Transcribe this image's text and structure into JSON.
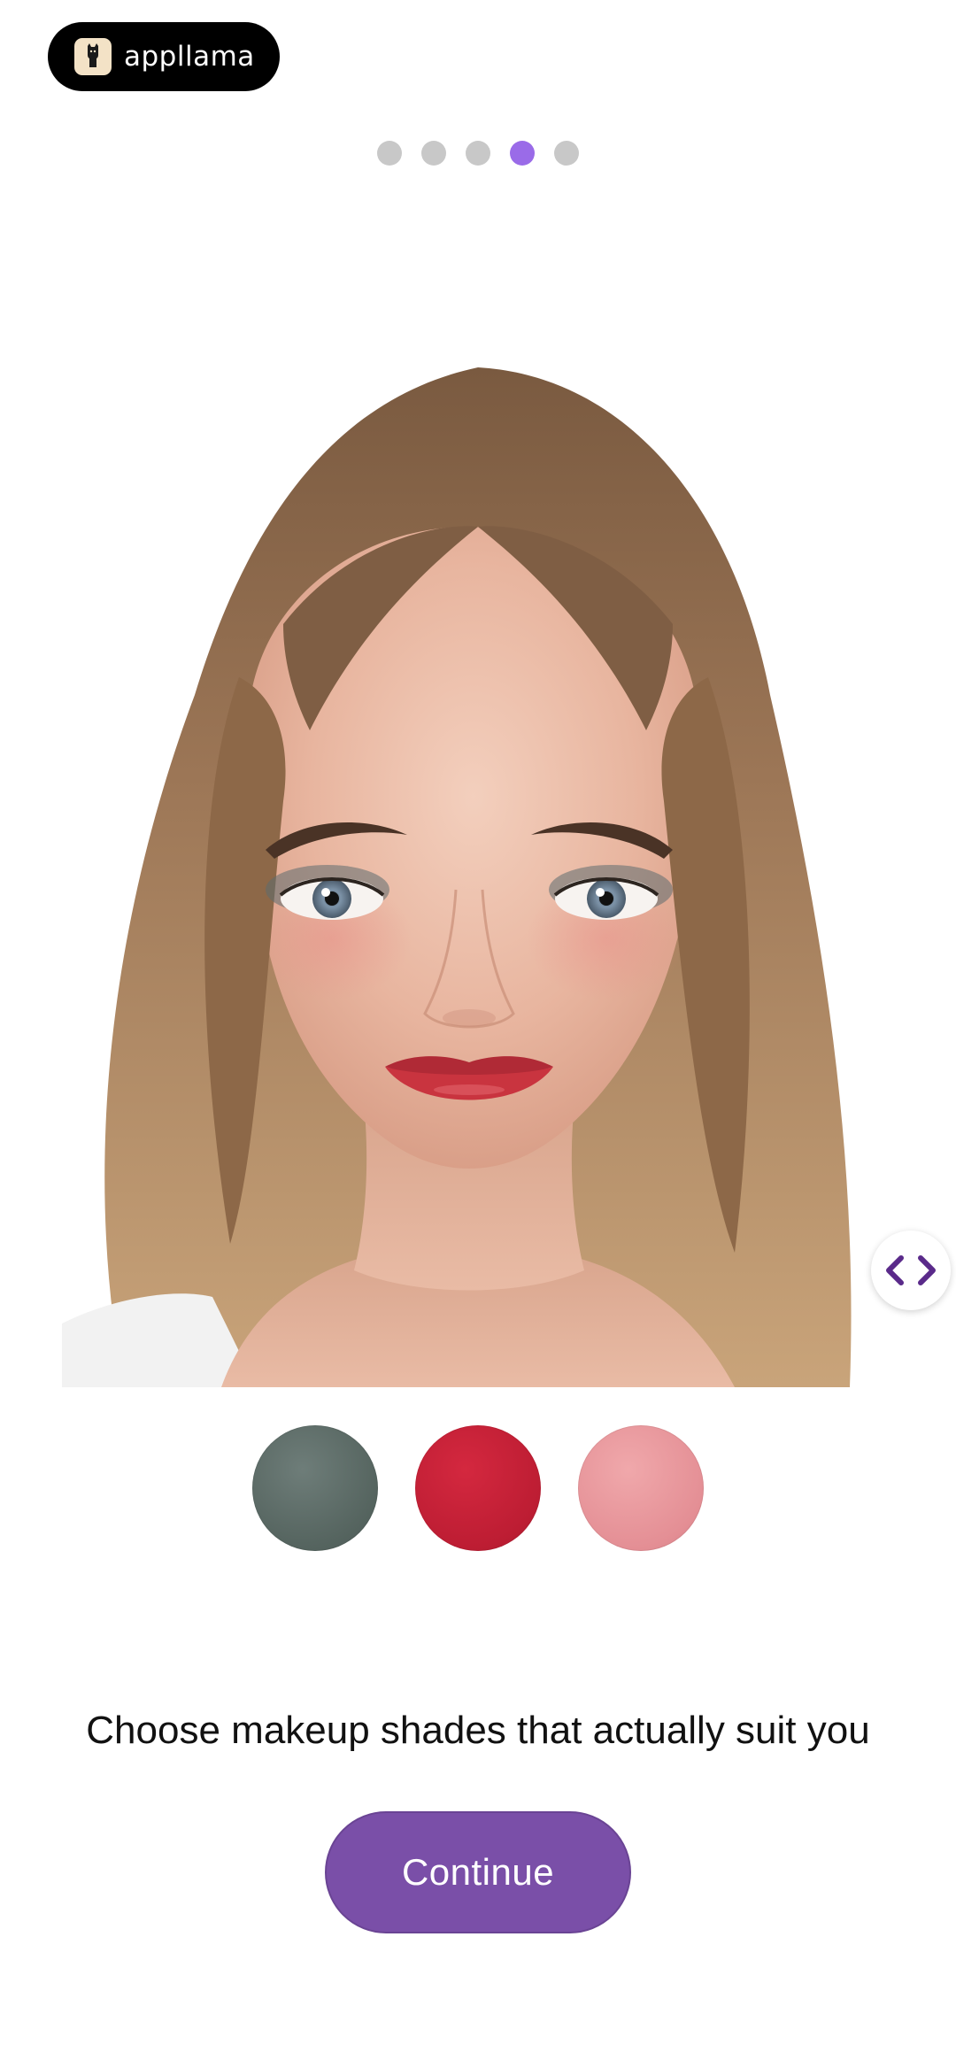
{
  "brand": {
    "name": "appllama",
    "logo_icon": "llama-icon"
  },
  "pager": {
    "total": 5,
    "current": 4,
    "active_color": "#9a6be8",
    "inactive_color": "#c8c8c8"
  },
  "hero": {
    "image": "woman-portrait-makeup",
    "compare_icon": "chevron-left-right-icon"
  },
  "swatches": [
    {
      "name": "eyeshadow-shade",
      "color": "#5c6b67"
    },
    {
      "name": "lipstick-shade",
      "color": "#c01e33"
    },
    {
      "name": "blush-shade",
      "color": "#e8959a"
    }
  ],
  "headline": "Choose makeup shades that actually suit you",
  "continue_button": {
    "label": "Continue",
    "color": "#7a4fa8"
  }
}
